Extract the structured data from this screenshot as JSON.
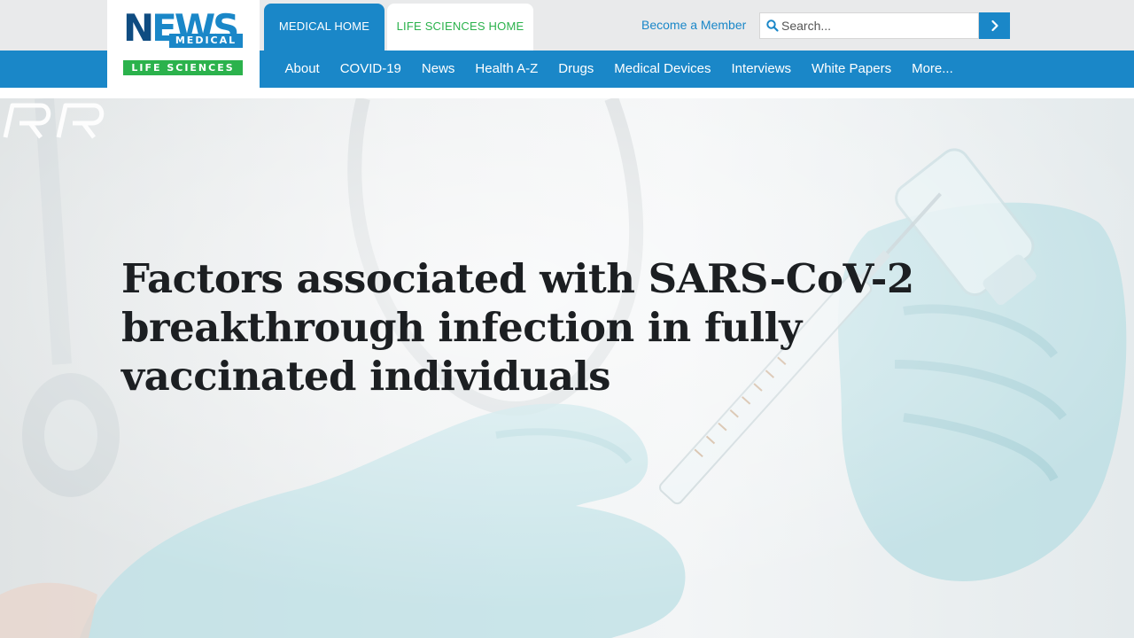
{
  "brand": {
    "logo_n": "N",
    "logo_ews": "EWS",
    "logo_medical": "MEDICAL",
    "logo_life": "LIFE SCIENCES",
    "primary_color": "#1a87c8",
    "dark_color": "#0f4c81",
    "green_color": "#2bb24c"
  },
  "tabs": [
    {
      "label": "MEDICAL HOME",
      "active": true
    },
    {
      "label": "LIFE SCIENCES HOME",
      "active": false
    }
  ],
  "header": {
    "member_link": "Become a Member",
    "search_placeholder": "Search...",
    "search_icon": "search-icon",
    "submit_icon": "chevron-right-icon"
  },
  "nav": {
    "items": [
      "About",
      "COVID-19",
      "News",
      "Health A-Z",
      "Drugs",
      "Medical Devices",
      "Interviews",
      "White Papers",
      "More..."
    ]
  },
  "hero": {
    "title": "Factors associated with SARS-CoV-2 breakthrough infection in fully vaccinated individuals",
    "watermark_icon": "rr-logo-watermark"
  }
}
